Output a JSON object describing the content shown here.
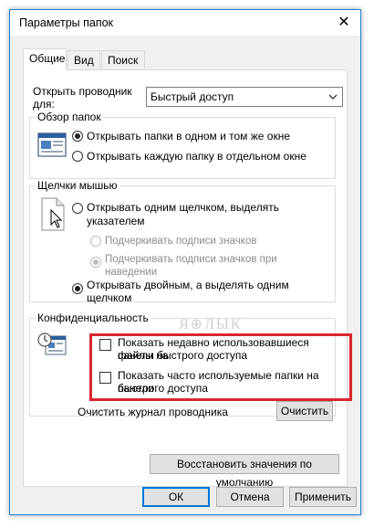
{
  "window": {
    "title": "Параметры папок",
    "close_symbol": "✕"
  },
  "tabs": [
    {
      "label": "Общие"
    },
    {
      "label": "Вид"
    },
    {
      "label": "Поиск"
    }
  ],
  "open_explorer": {
    "label": "Открыть проводник для:",
    "value": "Быстрый доступ"
  },
  "browse": {
    "legend": "Обзор папок",
    "options": [
      {
        "label": "Открывать папки в одном и том же окне"
      },
      {
        "label": "Открывать каждую папку в отдельном окне"
      }
    ]
  },
  "clicks": {
    "legend": "Щелчки мышью",
    "single_line1": "Открывать одним щелчком, выделять",
    "single_line2": "указателем",
    "sub1": "Подчеркивать подписи значков",
    "sub2_line1": "Подчеркивать подписи значков при",
    "sub2_line2": "наведении",
    "double_line1": "Открывать двойным, а выделять одним",
    "double_line2": "щелчком"
  },
  "privacy": {
    "legend": "Конфиденциальность",
    "recent_line1": "Показать недавно использовавшиеся файлы на",
    "recent_line2": "панели быстрого доступа",
    "frequent_line1": "Показать часто используемые папки на панели",
    "frequent_line2": "быстрого доступа",
    "clear_label": "Очистить журнал проводника",
    "clear_button": "Очистить"
  },
  "restore_button": "Восстановить значения по умолчанию",
  "footer": {
    "ok": "ОК",
    "cancel": "Отмена",
    "apply": "Применить"
  },
  "watermark": "Я⊕ЛЫК",
  "colors": {
    "accent": "#0078d7",
    "highlight": "#d9272d"
  }
}
